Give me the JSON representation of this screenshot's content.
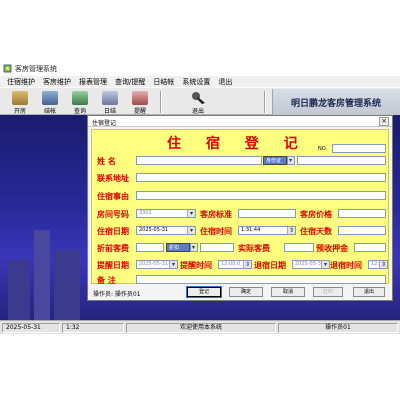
{
  "window": {
    "title": "客房管理系统",
    "icon": "app-icon"
  },
  "menu": [
    "住宿维护",
    "客房维护",
    "报表管理",
    "查询/提醒",
    "日结帐",
    "系统设置",
    "退出"
  ],
  "toolbar": {
    "buttons": [
      {
        "label": "开房",
        "icon": "open-room-icon"
      },
      {
        "label": "结帐",
        "icon": "checkout-icon"
      },
      {
        "label": "查询",
        "icon": "query-icon"
      },
      {
        "label": "日结",
        "icon": "daily-icon"
      },
      {
        "label": "提醒",
        "icon": "reminder-icon"
      },
      {
        "label": "退出",
        "icon": "exit-icon"
      }
    ],
    "app_name": "明日鹏龙客房管理系统"
  },
  "dialog": {
    "title": "住宿登记",
    "close": "×",
    "heading": "住 宿 登 记",
    "no_label": "NO.",
    "no_value": "",
    "labels": {
      "name": "姓    名",
      "address": "联系地址",
      "reason": "住宿事由",
      "room_no": "房间号码",
      "room_std": "客房标准",
      "room_price": "客房价格",
      "check_in_date": "住宿日期",
      "check_in_time": "住宿时间",
      "days": "住宿天数",
      "discount": "折前客费",
      "actual_fee": "实际客费",
      "deposit": "预收押金",
      "remind_date": "提醒日期",
      "remind_time": "提醒时间",
      "checkout_date": "退宿日期",
      "checkout_time": "退宿时间",
      "remark": "备    注"
    },
    "values": {
      "name": "",
      "id_type": "身份证",
      "id_no": "",
      "address": "",
      "reason": "",
      "room_no": "3301",
      "room_std": "",
      "room_price": "",
      "check_in_date": "2025-05-31",
      "check_in_time": "1:31:44",
      "days": "",
      "discount_type": "折扣",
      "discount_value": "",
      "actual_fee": "",
      "deposit": "",
      "remind_date": "2025-05-31",
      "remind_time": "12:00:0",
      "checkout_date": "2025-05-3",
      "checkout_time": "12:00:0",
      "remark": ""
    },
    "operator": "操作员: 操作员01",
    "buttons": [
      "登记",
      "确定",
      "取消",
      "打印",
      "退出"
    ]
  },
  "status": {
    "date": "2025-05-31",
    "time": "1:32",
    "message": "欢迎使用本系统",
    "operator": "操作员01"
  },
  "colors": {
    "form_bg": "#ffff80",
    "label_red": "#e00000",
    "desktop": "#272a9a"
  }
}
